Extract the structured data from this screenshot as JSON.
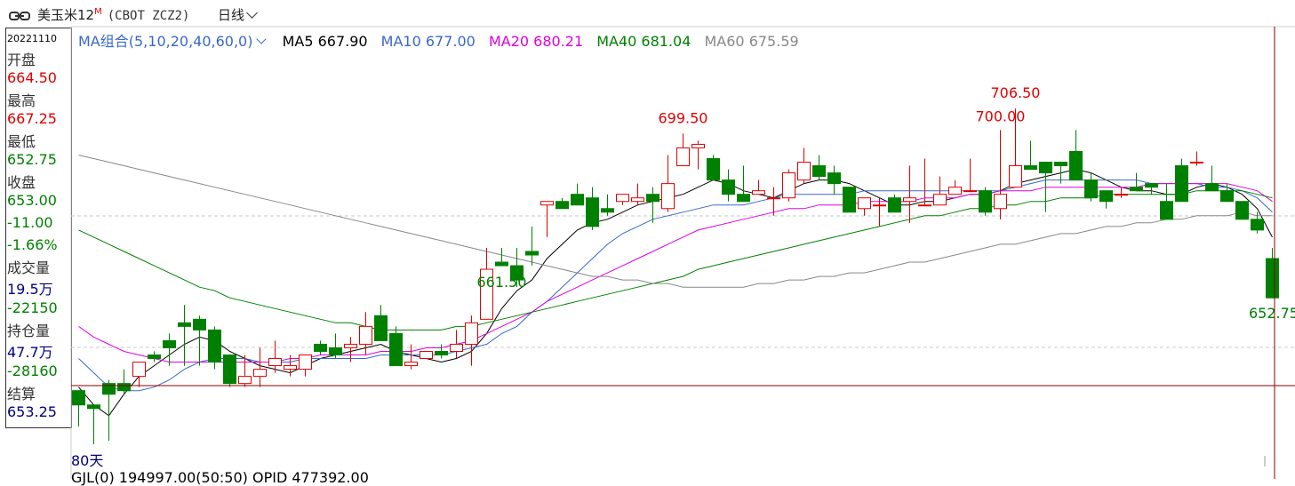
{
  "header": {
    "title": "美玉米12",
    "title_sup": "M",
    "code": "(CBOT ZCZ2)",
    "period": "日线"
  },
  "info_panel": {
    "date": "20221110",
    "open_label": "开盘",
    "open": "664.50",
    "high_label": "最高",
    "high": "667.25",
    "low_label": "最低",
    "low": "652.75",
    "close_label": "收盘",
    "close": "653.00",
    "change": "-11.00",
    "change_pct": "-1.66%",
    "volume_label": "成交量",
    "volume": "19.5万",
    "volume_change": "-22150",
    "oi_label": "持仓量",
    "oi": "47.7万",
    "oi_change": "-28160",
    "settle_label": "结算",
    "settle": "653.25"
  },
  "ma_legend": {
    "group": "MA组合(5,10,20,40,60,0)",
    "ma5": "MA5 667.90",
    "ma10": "MA10 677.00",
    "ma20": "MA20 680.21",
    "ma40": "MA40 681.04",
    "ma60": "MA60 675.59"
  },
  "bottom": {
    "days": "80天",
    "strip": "GJL(0)   194997.00(50:50)   OPID 477392.00"
  },
  "colors": {
    "up": "#e00000",
    "down": "#008000",
    "ma5": "#000000",
    "ma10": "#3a68c8",
    "ma20": "#e000e0",
    "ma40": "#008000",
    "ma60": "#888888"
  },
  "chart_data": {
    "type": "candlestick",
    "ylim": [
      610,
      720
    ],
    "annotations": [
      {
        "text": "699.50",
        "kind": "high"
      },
      {
        "text": "706.50",
        "kind": "high"
      },
      {
        "text": "700.00",
        "kind": "high"
      },
      {
        "text": "661.50",
        "kind": "low"
      },
      {
        "text": "652.75",
        "kind": "low"
      }
    ],
    "candles": [
      [
        627,
        623,
        627,
        617
      ],
      [
        623,
        622,
        623,
        612
      ],
      [
        629,
        626,
        630,
        613
      ],
      [
        629,
        627,
        633,
        626
      ],
      [
        631,
        635,
        635,
        628
      ],
      [
        637,
        636,
        638,
        635
      ],
      [
        641,
        639,
        643,
        634
      ],
      [
        646,
        645,
        651,
        634
      ],
      [
        647,
        644,
        648,
        634
      ],
      [
        644,
        635,
        645,
        633
      ],
      [
        637,
        629,
        637,
        628
      ],
      [
        629,
        631,
        637,
        628
      ],
      [
        631,
        633,
        639,
        628
      ],
      [
        634,
        636,
        641,
        632
      ],
      [
        633,
        634,
        637,
        631
      ],
      [
        633,
        637,
        637,
        631
      ],
      [
        640,
        638,
        641,
        637
      ],
      [
        639,
        637,
        643,
        636
      ],
      [
        639,
        640,
        642,
        635
      ],
      [
        640,
        645,
        649,
        637
      ],
      [
        648,
        641,
        651,
        641
      ],
      [
        643,
        634,
        645,
        634
      ],
      [
        634,
        635,
        640,
        633
      ],
      [
        636,
        638,
        637,
        636
      ],
      [
        638,
        637,
        640,
        636
      ],
      [
        638,
        640,
        644,
        636
      ],
      [
        640,
        646,
        648,
        634
      ],
      [
        647,
        661,
        667,
        647
      ],
      [
        663,
        662,
        667,
        662
      ],
      [
        662,
        658,
        667,
        656
      ],
      [
        666,
        665,
        673,
        662
      ],
      [
        679,
        680,
        680,
        670
      ],
      [
        680,
        678,
        681,
        678
      ],
      [
        682,
        679,
        685,
        679
      ],
      [
        681,
        673,
        684,
        672
      ],
      [
        678,
        677,
        682,
        676
      ],
      [
        680,
        682,
        682,
        679
      ],
      [
        680,
        681,
        685,
        679
      ],
      [
        682,
        680,
        684,
        674
      ],
      [
        678,
        685,
        693,
        677
      ],
      [
        690,
        695,
        699,
        690
      ],
      [
        695,
        696,
        697,
        689
      ],
      [
        692,
        686,
        693,
        686
      ],
      [
        686,
        682,
        689,
        680
      ],
      [
        682,
        680,
        690,
        680
      ],
      [
        682,
        683,
        686,
        682
      ],
      [
        681,
        681,
        684,
        676
      ],
      [
        681,
        688,
        689,
        680
      ],
      [
        686,
        691,
        695,
        685
      ],
      [
        690,
        687,
        693,
        686
      ],
      [
        688,
        685,
        690,
        682
      ],
      [
        684,
        677,
        684,
        677
      ],
      [
        678,
        681,
        681,
        676
      ],
      [
        679,
        679,
        681,
        673
      ],
      [
        681,
        677,
        682,
        677
      ],
      [
        680,
        681,
        690,
        674
      ],
      [
        679,
        679,
        692,
        679
      ],
      [
        679,
        682,
        687,
        681
      ],
      [
        682,
        684,
        686,
        682
      ],
      [
        683,
        683,
        692,
        684
      ],
      [
        683,
        677,
        684,
        676
      ],
      [
        678,
        682,
        700,
        675
      ],
      [
        684,
        690,
        706,
        687
      ],
      [
        690,
        689,
        697,
        689
      ],
      [
        691,
        688,
        691,
        677
      ],
      [
        691,
        690,
        690,
        685
      ],
      [
        694,
        686,
        700,
        686
      ],
      [
        686,
        681,
        688,
        680
      ],
      [
        683,
        680,
        682,
        678
      ],
      [
        682,
        682,
        684,
        681
      ],
      [
        684,
        683,
        688,
        683
      ],
      [
        685,
        684,
        685,
        682
      ],
      [
        680,
        675,
        685,
        679
      ],
      [
        690,
        680,
        692,
        680
      ],
      [
        691,
        691,
        694,
        690
      ],
      [
        685,
        683,
        690,
        683
      ],
      [
        683,
        680,
        685,
        682
      ],
      [
        680,
        675,
        680,
        675
      ],
      [
        675,
        672,
        677,
        671
      ],
      [
        664,
        653,
        667,
        653
      ]
    ],
    "series": [
      {
        "name": "MA5",
        "values": [
          628,
          623,
          620,
          626,
          631,
          634,
          637,
          640,
          642,
          641,
          638,
          636,
          634,
          633,
          632,
          634,
          636,
          637,
          638,
          639,
          640,
          638,
          637,
          636,
          635,
          636,
          638,
          643,
          650,
          655,
          658,
          664,
          668,
          672,
          674,
          675,
          677,
          679,
          680,
          681,
          682,
          684,
          686,
          685,
          683,
          682,
          681,
          683,
          685,
          686,
          686,
          685,
          683,
          681,
          679,
          679,
          680,
          680,
          681,
          682,
          682,
          683,
          685,
          686,
          687,
          688,
          689,
          688,
          686,
          684,
          683,
          683,
          682,
          682,
          684,
          685,
          684,
          682,
          678,
          670
        ]
      },
      {
        "name": "MA10",
        "values": [
          636,
          632,
          628,
          627,
          627,
          628,
          630,
          633,
          635,
          636,
          636,
          636,
          635,
          635,
          635,
          636,
          636,
          636,
          636,
          636,
          637,
          637,
          637,
          637,
          637,
          638,
          639,
          640,
          643,
          645,
          649,
          652,
          656,
          660,
          664,
          668,
          671,
          673,
          675,
          676,
          677,
          678,
          679,
          679,
          679,
          680,
          681,
          682,
          682,
          682,
          682,
          682,
          683,
          683,
          683,
          683,
          683,
          683,
          683,
          683,
          683,
          683,
          684,
          685,
          686,
          686,
          686,
          686,
          686,
          686,
          686,
          685,
          685,
          685,
          685,
          684,
          684,
          683,
          681,
          677
        ]
      },
      {
        "name": "MA20",
        "values": [
          645,
          642,
          640,
          638,
          637,
          636,
          635,
          635,
          635,
          635,
          635,
          635,
          635,
          635,
          636,
          636,
          637,
          637,
          637,
          637,
          638,
          638,
          638,
          639,
          639,
          640,
          641,
          643,
          645,
          647,
          649,
          652,
          654,
          656,
          658,
          660,
          662,
          664,
          666,
          668,
          670,
          672,
          673,
          674,
          675,
          676,
          677,
          678,
          678,
          679,
          679,
          679,
          680,
          680,
          680,
          680,
          681,
          681,
          681,
          682,
          682,
          683,
          683,
          683,
          684,
          684,
          684,
          684,
          684,
          684,
          684,
          685,
          685,
          685,
          685,
          685,
          685,
          684,
          683,
          680
        ]
      },
      {
        "name": "MA40",
        "values": [
          672,
          670,
          668,
          666,
          664,
          662,
          660,
          658,
          656,
          655,
          653,
          652,
          651,
          650,
          649,
          648,
          647,
          646,
          646,
          645,
          644,
          644,
          644,
          644,
          644,
          645,
          645,
          646,
          647,
          648,
          649,
          650,
          651,
          652,
          653,
          654,
          655,
          656,
          657,
          658,
          659,
          661,
          662,
          663,
          664,
          665,
          666,
          667,
          668,
          669,
          670,
          671,
          672,
          673,
          674,
          675,
          676,
          676,
          677,
          678,
          678,
          679,
          679,
          680,
          680,
          681,
          681,
          681,
          682,
          682,
          682,
          682,
          682,
          682,
          683,
          683,
          683,
          683,
          682,
          681
        ]
      },
      {
        "name": "MA60",
        "values": [
          693,
          692,
          691,
          690,
          689,
          688,
          687,
          686,
          685,
          684,
          683,
          682,
          681,
          680,
          679,
          678,
          677,
          676,
          675,
          674,
          673,
          672,
          671,
          670,
          669,
          668,
          667,
          666,
          665,
          664,
          663,
          662,
          661,
          660,
          659,
          659,
          658,
          658,
          657,
          657,
          656,
          656,
          656,
          656,
          656,
          657,
          657,
          658,
          658,
          659,
          659,
          660,
          660,
          661,
          662,
          663,
          663,
          664,
          665,
          666,
          667,
          668,
          668,
          669,
          670,
          671,
          671,
          672,
          673,
          673,
          674,
          674,
          675,
          675,
          676,
          676,
          676,
          677,
          676,
          676
        ]
      }
    ]
  }
}
